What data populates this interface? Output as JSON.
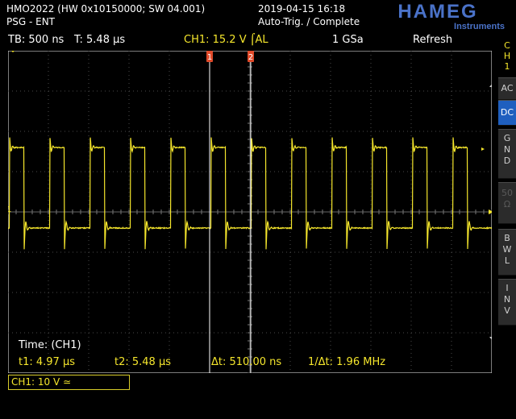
{
  "header": {
    "model": "HMO2022 (HW 0x10150000; SW 04.001)",
    "mode": "PSG - ENT",
    "datetime": "2019-04-15 16:18",
    "trigger_status": "Auto-Trig. / Complete",
    "brand": "HAMEG",
    "brand_sub": "Instruments"
  },
  "status_bar": {
    "timebase": "TB: 500 ns",
    "trigger_time": "T: 5.48 µs",
    "channel_trigger": "CH1: 15.2 V ⌠AL",
    "sample_rate": "1 GSa",
    "acq_mode": "Refresh"
  },
  "side_menu": {
    "channel_top": "C",
    "channel_h": "H",
    "channel_num": "1",
    "ac": "AC",
    "dc": "DC",
    "gnd": [
      "G",
      "N",
      "D"
    ],
    "ohm": [
      "50",
      "Ω"
    ],
    "bwl": [
      "B",
      "W",
      "L"
    ],
    "inv": [
      "I",
      "N",
      "V"
    ]
  },
  "cursors": {
    "c1_label": "1",
    "c2_label": "2"
  },
  "measurements": {
    "title": "Time: (CH1)",
    "t1": "t1: 4.97 µs",
    "t2": "t2: 5.48 µs",
    "dt": "Δt: 510.00 ns",
    "inv_dt": "1/Δt: 1.96 MHz"
  },
  "channel_box": {
    "label": "CH1: 10 V ≃"
  },
  "colors": {
    "trace": "#f5e62c",
    "grid": "#4a4a4a",
    "cursor": "#ffffff",
    "cursor_marker": "#e04a2a",
    "active_button": "#1f5fbf"
  },
  "chart_data": {
    "type": "line",
    "title": "",
    "xlabel": "",
    "ylabel": "",
    "time_per_div_ns": 500,
    "volts_per_div": 10,
    "period_ns": 500,
    "high_level_div": 1.6,
    "low_level_div": -0.4,
    "cursor_t1_us": 4.97,
    "cursor_t2_us": 5.48
  }
}
